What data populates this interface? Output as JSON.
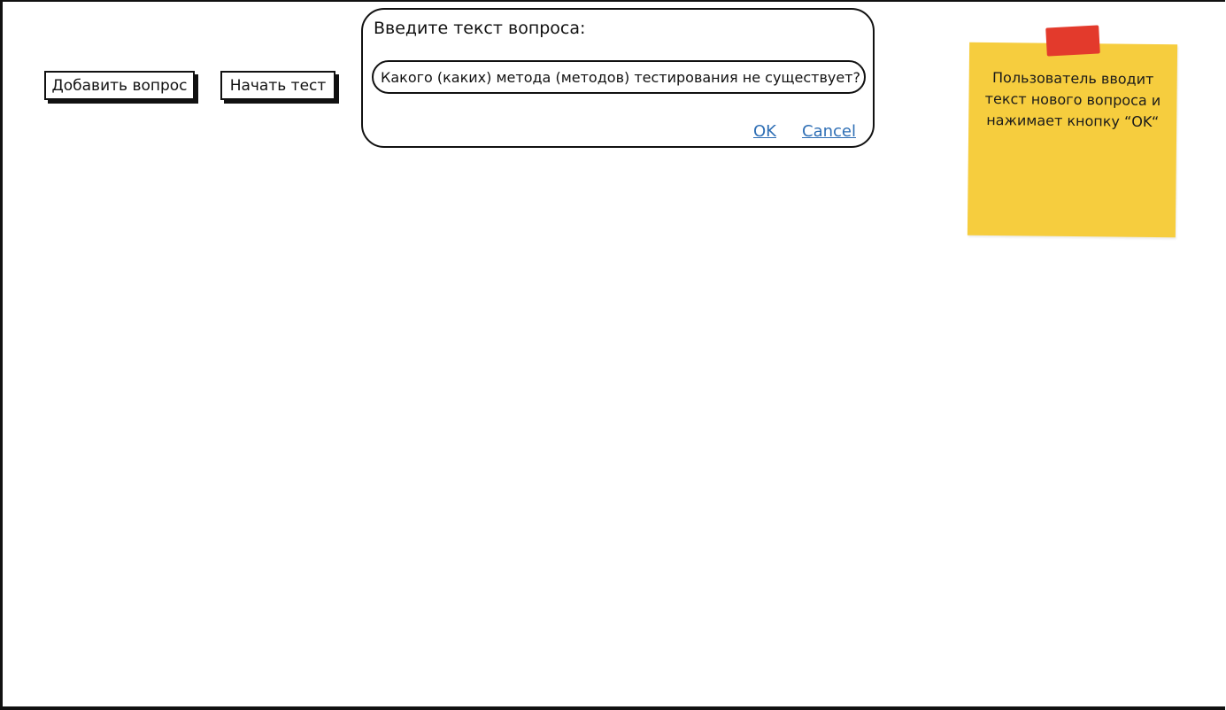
{
  "toolbar": {
    "add_question_label": "Добавить вопрос",
    "start_test_label": "Начать тест"
  },
  "dialog": {
    "title": "Введите текст вопроса:",
    "input_value": "Какого (каких) метода (методов) тестирования не существует?",
    "ok_label": "OK",
    "cancel_label": "Cancel"
  },
  "note": {
    "text": "Пользователь вводит текст нового вопроса и нажимает кнопку “OK“",
    "color": "#f6cd3e",
    "tape_color": "#e33a2c"
  },
  "colors": {
    "link": "#2f6fb5",
    "border": "#111111"
  }
}
